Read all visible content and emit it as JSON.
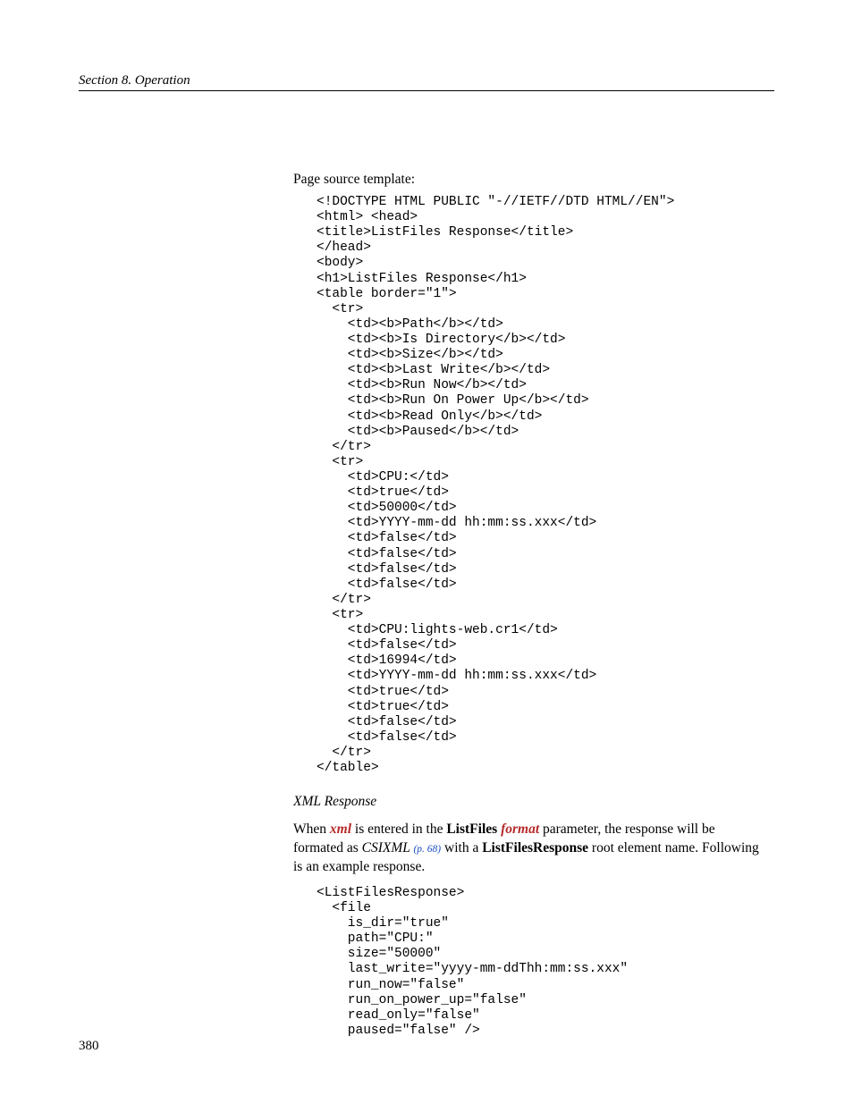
{
  "header": "Section 8.  Operation",
  "intro": "Page source template:",
  "code1": "<!DOCTYPE HTML PUBLIC \"-//IETF//DTD HTML//EN\">\n<html> <head>\n<title>ListFiles Response</title>\n</head>\n<body>\n<h1>ListFiles Response</h1>\n<table border=\"1\">\n  <tr>\n    <td><b>Path</b></td>\n    <td><b>Is Directory</b></td>\n    <td><b>Size</b></td>\n    <td><b>Last Write</b></td>\n    <td><b>Run Now</b></td>\n    <td><b>Run On Power Up</b></td>\n    <td><b>Read Only</b></td>\n    <td><b>Paused</b></td>\n  </tr>\n  <tr>\n    <td>CPU:</td>\n    <td>true</td>\n    <td>50000</td>\n    <td>YYYY-mm-dd hh:mm:ss.xxx</td>\n    <td>false</td>\n    <td>false</td>\n    <td>false</td>\n    <td>false</td>\n  </tr>\n  <tr>\n    <td>CPU:lights-web.cr1</td>\n    <td>false</td>\n    <td>16994</td>\n    <td>YYYY-mm-dd hh:mm:ss.xxx</td>\n    <td>true</td>\n    <td>true</td>\n    <td>false</td>\n    <td>false</td>\n  </tr>\n</table>",
  "subheading": "XML Response",
  "para_parts": {
    "p1": "When ",
    "xml": "xml",
    "p2": " is entered in the ",
    "listfiles": "ListFiles",
    "p3": " ",
    "format": "format",
    "p4": " parameter, the response will be formated as ",
    "csixml": "CSIXML ",
    "pref": "(p. 68)",
    "p5": " with a ",
    "lfr": "ListFilesResponse",
    "p6": " root element name. Following is an example response."
  },
  "code2": "<ListFilesResponse>\n  <file\n    is_dir=\"true\"\n    path=\"CPU:\"\n    size=\"50000\"\n    last_write=\"yyyy-mm-ddThh:mm:ss.xxx\"\n    run_now=\"false\"\n    run_on_power_up=\"false\"\n    read_only=\"false\"\n    paused=\"false\" />",
  "page_number": "380"
}
